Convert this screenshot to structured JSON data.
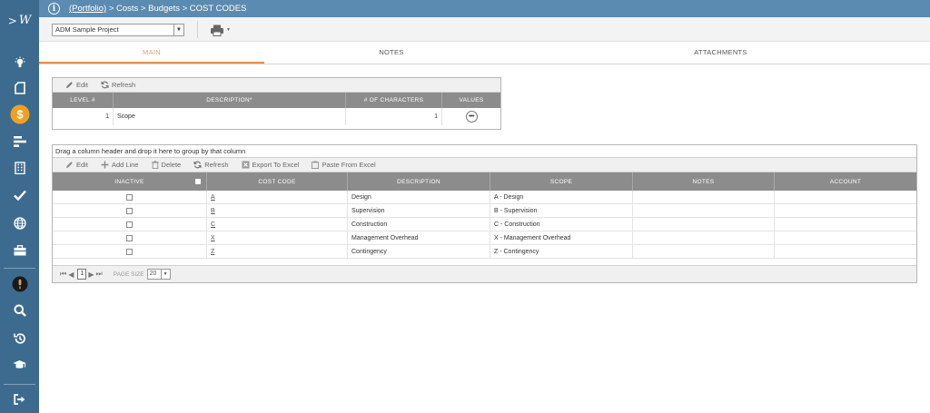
{
  "app": {
    "logo_text": "W",
    "logo_chevron": ">"
  },
  "breadcrumb": {
    "portfolio": "(Portfolio)",
    "rest": " > Costs > Budgets > COST CODES"
  },
  "toolbar": {
    "project_select": "ADM Sample Project"
  },
  "tabs": [
    {
      "label": "MAIN",
      "active": true
    },
    {
      "label": "NOTES",
      "active": false
    },
    {
      "label": "ATTACHMENTS",
      "active": false
    }
  ],
  "levels_grid": {
    "toolbar": {
      "edit": "Edit",
      "refresh": "Refresh"
    },
    "columns": [
      "LEVEL #",
      "DESCRIPTION*",
      "# OF CHARACTERS",
      "VALUES"
    ],
    "rows": [
      {
        "level": "1",
        "description": "Scope",
        "chars": "1"
      }
    ]
  },
  "codes_grid": {
    "group_hint": "Drag a column header and drop it here to group by that column",
    "toolbar": {
      "edit": "Edit",
      "add_line": "Add Line",
      "delete": "Delete",
      "refresh": "Refresh",
      "export": "Export To Excel",
      "paste": "Paste From Excel"
    },
    "columns": [
      "INACTIVE",
      "COST CODE",
      "DESCRIPTION",
      "SCOPE",
      "NOTES",
      "ACCOUNT"
    ],
    "rows": [
      {
        "code": "A",
        "description": "Design",
        "scope": "A - Design",
        "notes": "",
        "account": ""
      },
      {
        "code": "B",
        "description": "Supervision",
        "scope": "B - Supervision",
        "notes": "",
        "account": ""
      },
      {
        "code": "C",
        "description": "Construction",
        "scope": "C - Construction",
        "notes": "",
        "account": ""
      },
      {
        "code": "X",
        "description": "Management Overhead",
        "scope": "X - Management Overhead",
        "notes": "",
        "account": ""
      },
      {
        "code": "Z",
        "description": "Contingency",
        "scope": "Z - Contingency",
        "notes": "",
        "account": ""
      }
    ],
    "pager": {
      "page": "1",
      "page_size_label": "PAGE SIZE",
      "page_size": "20"
    }
  },
  "colors": {
    "sidebar": "#3d6b8f",
    "topbar": "#5b8bb0",
    "accent": "#e09050",
    "dollar_badge": "#f0a020"
  },
  "sidebar_icons": [
    "lightbulb-icon",
    "document-icon",
    "dollar-icon",
    "gantt-icon",
    "building-icon",
    "check-icon",
    "globe-icon",
    "briefcase-icon",
    "mic-icon",
    "search-icon",
    "history-icon",
    "graduation-cap-icon",
    "logout-icon"
  ]
}
